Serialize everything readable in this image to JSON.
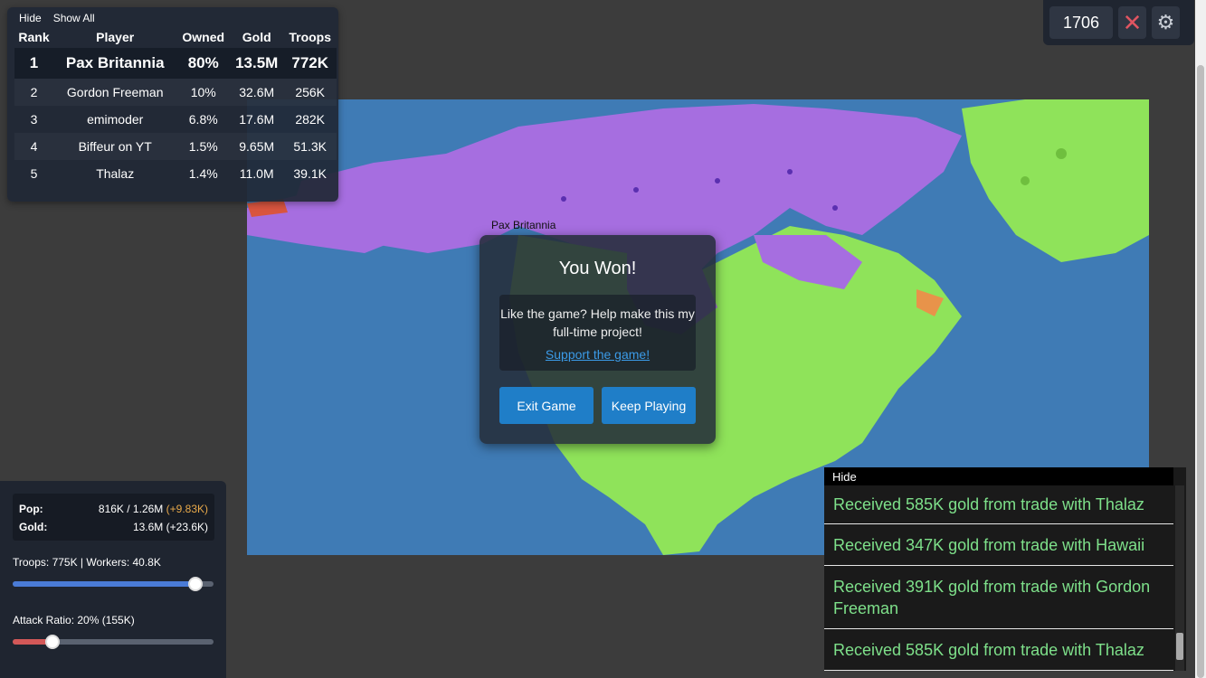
{
  "leaderboard": {
    "hide_label": "Hide",
    "show_all_label": "Show All",
    "headers": [
      "Rank",
      "Player",
      "Owned",
      "Gold",
      "Troops"
    ],
    "rows": [
      {
        "rank": "1",
        "player": "Pax Britannia",
        "owned": "80%",
        "gold": "13.5M",
        "troops": "772K"
      },
      {
        "rank": "2",
        "player": "Gordon Freeman",
        "owned": "10%",
        "gold": "32.6M",
        "troops": "256K"
      },
      {
        "rank": "3",
        "player": "emimoder",
        "owned": "6.8%",
        "gold": "17.6M",
        "troops": "282K"
      },
      {
        "rank": "4",
        "player": "Biffeur on YT",
        "owned": "1.5%",
        "gold": "9.65M",
        "troops": "51.3K"
      },
      {
        "rank": "5",
        "player": "Thalaz",
        "owned": "1.4%",
        "gold": "11.0M",
        "troops": "39.1K"
      }
    ]
  },
  "top_controls": {
    "timer": "1706",
    "close_icon": "✕",
    "gear_icon": "⚙"
  },
  "map": {
    "player_label": "Pax Britannia",
    "colors": {
      "ocean": "#3f7bb5",
      "player": "#a66ee0",
      "green": "#8fe35a"
    }
  },
  "win_modal": {
    "title": "You Won!",
    "message": "Like the game? Help make this my full-time project!",
    "support_link": "Support the game!",
    "exit_button": "Exit Game",
    "keep_button": "Keep Playing"
  },
  "control_panel": {
    "pop_label": "Pop:",
    "pop_value": "816K / 1.26M",
    "pop_increase": "(+9.83K)",
    "gold_label": "Gold:",
    "gold_value": "13.6M (+23.6K)",
    "troops_text": "Troops: 775K | Workers: 40.8K",
    "troop_ratio": 0.91,
    "attack_text": "Attack Ratio: 20% (155K)",
    "attack_ratio": 0.2
  },
  "events": {
    "hide_label": "Hide",
    "items": [
      "Received 585K gold from trade with Thalaz",
      "Received 347K gold from trade with Hawaii",
      "Received 391K gold from trade with Gordon Freeman",
      "Received 585K gold from trade with Thalaz"
    ]
  }
}
